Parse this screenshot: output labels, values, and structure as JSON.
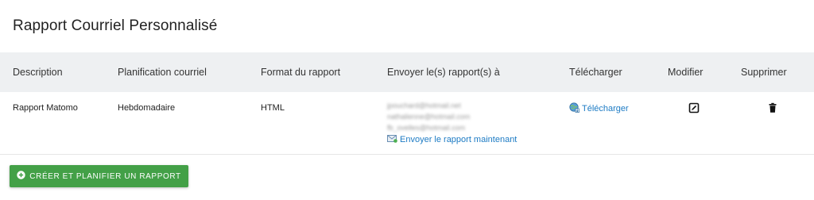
{
  "page": {
    "title": "Rapport Courriel Personnalisé"
  },
  "table": {
    "headers": {
      "description": "Description",
      "schedule": "Planification courriel",
      "format": "Format du rapport",
      "send_to": "Envoyer le(s) rapport(s) à",
      "download": "Télécharger",
      "edit": "Modifier",
      "delete": "Supprimer"
    },
    "rows": [
      {
        "description": "Rapport Matomo",
        "schedule": "Hebdomadaire",
        "format": "HTML",
        "recipients": [
          "jpouchard@hotmail.net",
          "nathalienne@hotmail.com",
          "fb_ovelles@hotmail.com"
        ],
        "send_now_label": "Envoyer le rapport maintenant",
        "download_label": "Télécharger"
      }
    ]
  },
  "actions": {
    "create_label": "CRÉER ET PLANIFIER UN RAPPORT"
  },
  "colors": {
    "header_bg": "#eef0f2",
    "link": "#1d7bc4",
    "primary_button": "#43a047"
  },
  "icons": {
    "download": "globe-download-icon",
    "send_now": "envelope-icon",
    "edit": "edit-icon",
    "delete": "trash-icon",
    "create": "plus-circle-icon"
  }
}
